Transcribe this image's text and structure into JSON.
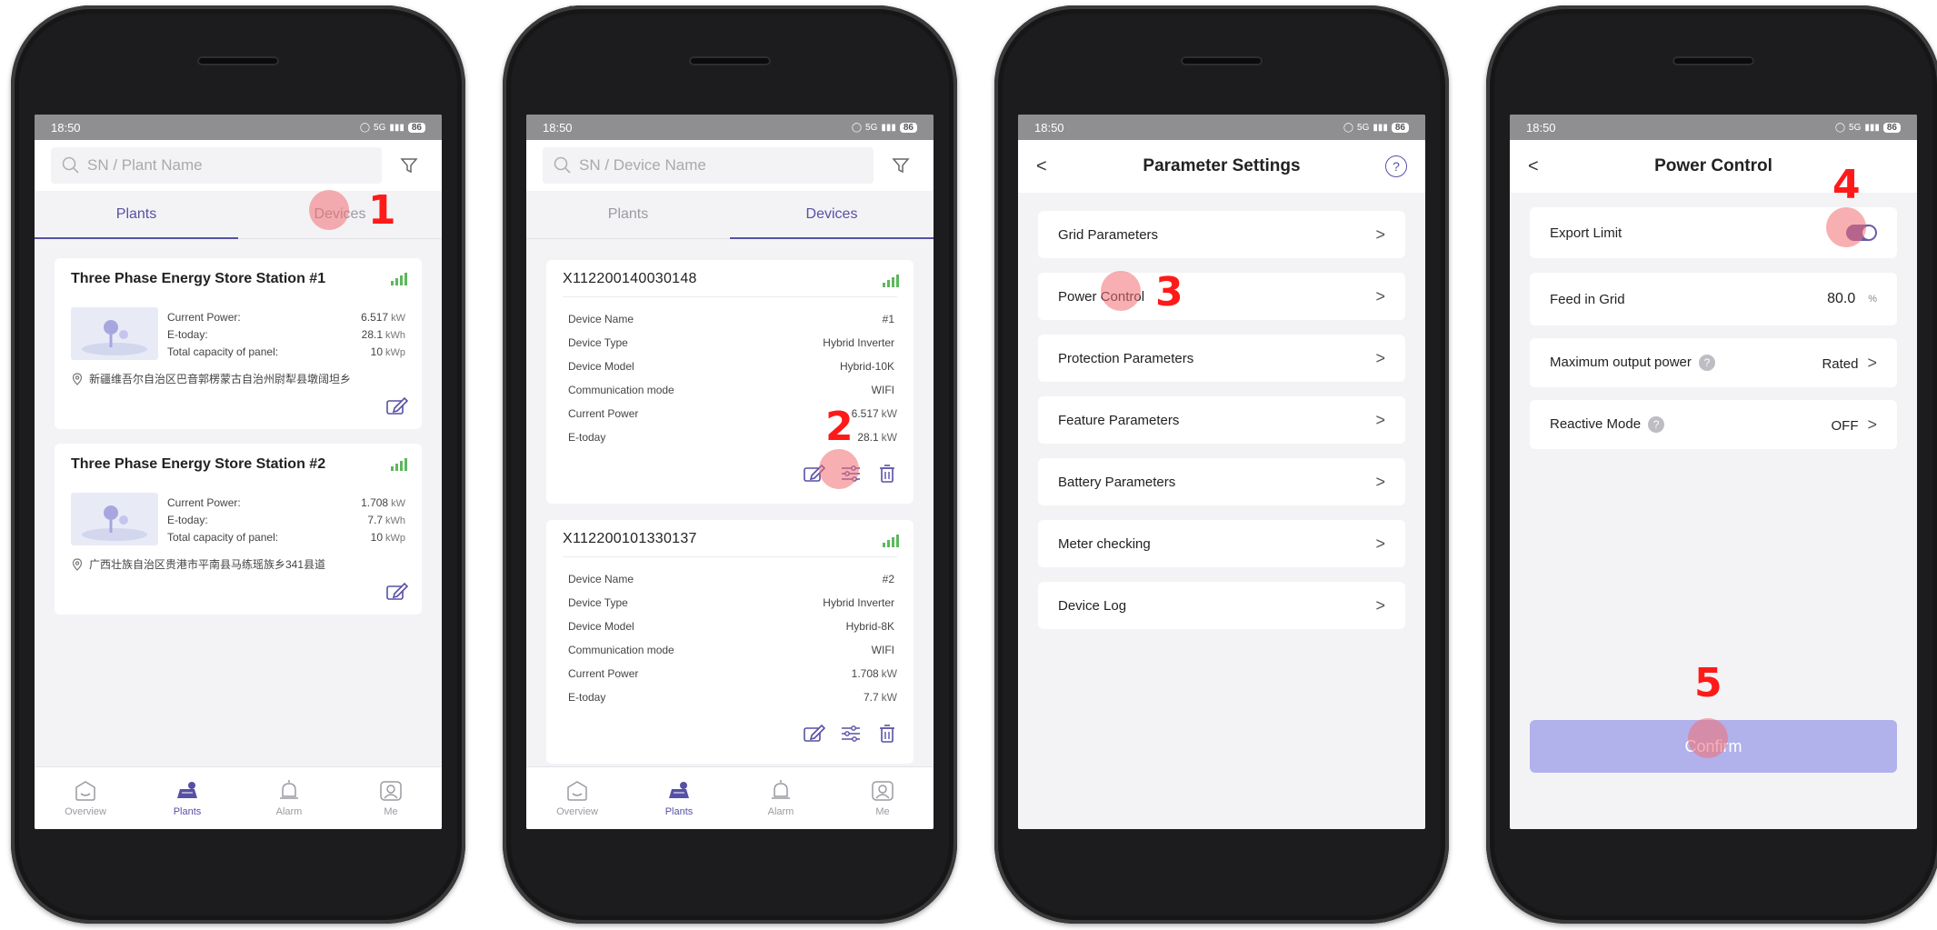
{
  "status_time": "18:50",
  "battery": "86",
  "status_icons_text": "5G",
  "nav": {
    "items": [
      {
        "label": "Overview"
      },
      {
        "label": "Plants"
      },
      {
        "label": "Alarm"
      },
      {
        "label": "Me"
      }
    ]
  },
  "screen1": {
    "search_placeholder": "SN / Plant Name",
    "tabs": [
      {
        "label": "Plants"
      },
      {
        "label": "Devices"
      }
    ],
    "stations": [
      {
        "title": "Three Phase Energy Store Station #1",
        "rows": [
          {
            "label": "Current Power:",
            "value": "6.517",
            "unit": "kW"
          },
          {
            "label": "E-today:",
            "value": "28.1",
            "unit": "kWh"
          },
          {
            "label": "Total capacity of panel:",
            "value": "10",
            "unit": "kWp"
          }
        ],
        "address": "新疆维吾尔自治区巴音郭楞蒙古自治州尉犁县墩阔坦乡"
      },
      {
        "title": "Three Phase Energy Store Station #2",
        "rows": [
          {
            "label": "Current Power:",
            "value": "1.708",
            "unit": "kW"
          },
          {
            "label": "E-today:",
            "value": "7.7",
            "unit": "kWh"
          },
          {
            "label": "Total capacity of panel:",
            "value": "10",
            "unit": "kWp"
          }
        ],
        "address": "广西壮族自治区贵港市平南县马练瑶族乡341县道"
      }
    ],
    "step": "1"
  },
  "screen2": {
    "search_placeholder": "SN / Device Name",
    "tabs": [
      {
        "label": "Plants"
      },
      {
        "label": "Devices"
      }
    ],
    "devices": [
      {
        "sn": "X112200140030148",
        "rows": [
          {
            "label": "Device Name",
            "value": "#1",
            "unit": ""
          },
          {
            "label": "Device Type",
            "value": "Hybrid Inverter",
            "unit": ""
          },
          {
            "label": "Device Model",
            "value": "Hybrid-10K",
            "unit": ""
          },
          {
            "label": "Communication mode",
            "value": "WIFI",
            "unit": ""
          },
          {
            "label": "Current Power",
            "value": "6.517",
            "unit": "kW"
          },
          {
            "label": "E-today",
            "value": "28.1",
            "unit": "kW"
          }
        ]
      },
      {
        "sn": "X112200101330137",
        "rows": [
          {
            "label": "Device Name",
            "value": "#2",
            "unit": ""
          },
          {
            "label": "Device Type",
            "value": "Hybrid Inverter",
            "unit": ""
          },
          {
            "label": "Device Model",
            "value": "Hybrid-8K",
            "unit": ""
          },
          {
            "label": "Communication mode",
            "value": "WIFI",
            "unit": ""
          },
          {
            "label": "Current Power",
            "value": "1.708",
            "unit": "kW"
          },
          {
            "label": "E-today",
            "value": "7.7",
            "unit": "kW"
          }
        ]
      }
    ],
    "step": "2"
  },
  "screen3": {
    "title": "Parameter Settings",
    "back": "<",
    "help": "?",
    "items": [
      {
        "label": "Grid Parameters"
      },
      {
        "label": "Power Control"
      },
      {
        "label": "Protection Parameters"
      },
      {
        "label": "Feature Parameters"
      },
      {
        "label": "Battery Parameters"
      },
      {
        "label": "Meter checking"
      },
      {
        "label": "Device Log"
      }
    ],
    "step": "3"
  },
  "screen4": {
    "title": "Power Control",
    "back": "<",
    "export_limit_label": "Export Limit",
    "export_limit_on": true,
    "feed_label": "Feed in Grid",
    "feed_value": "80.0",
    "feed_unit": "%",
    "max_output_label": "Maximum output power",
    "max_output_value": "Rated",
    "reactive_label": "Reactive Mode",
    "reactive_value": "OFF",
    "qmark": "?",
    "confirm_label": "Confirm",
    "step4": "4",
    "step5": "5"
  },
  "colors": {
    "accent": "#5750a5",
    "tap": "#f26e73",
    "step": "#ff1a1a",
    "confirm": "#b1b1ec"
  }
}
